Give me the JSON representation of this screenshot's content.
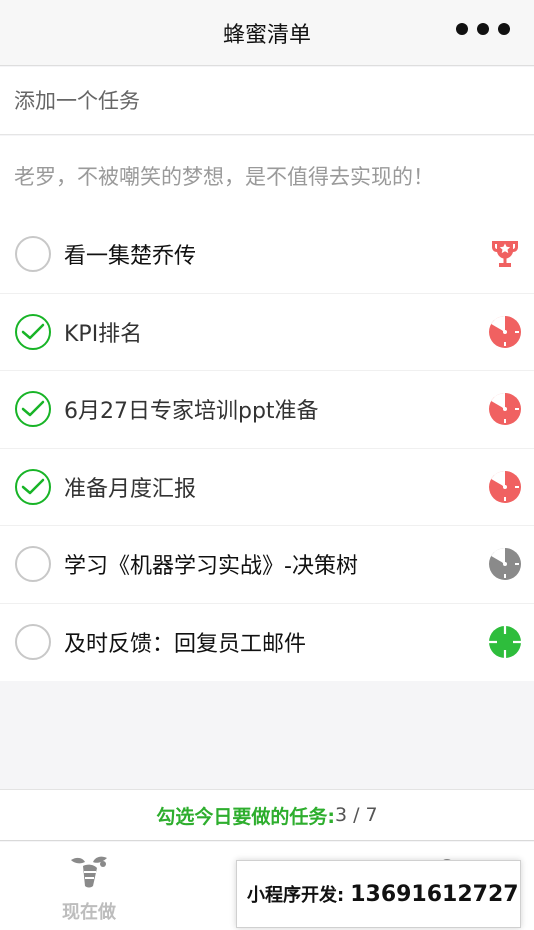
{
  "nav": {
    "title": "蜂蜜清单"
  },
  "add_task": {
    "placeholder": "添加一个任务"
  },
  "motto": "老罗，不被嘲笑的梦想，是不值得去实现的！",
  "tasks": [
    {
      "label": "看一集楚乔传",
      "done": false,
      "icon": "trophy-icon",
      "icon_color": "#f06161"
    },
    {
      "label": "KPI排名",
      "done": true,
      "icon": "clock-pie-icon",
      "icon_color": "#f06161"
    },
    {
      "label": "6月27日专家培训ppt准备",
      "done": true,
      "icon": "clock-pie-icon",
      "icon_color": "#f06161"
    },
    {
      "label": "准备月度汇报",
      "done": true,
      "icon": "clock-pie-icon",
      "icon_color": "#f06161"
    },
    {
      "label": "学习《机器学习实战》-决策树",
      "done": false,
      "icon": "clock-pie-icon",
      "icon_color": "#8a8a8a"
    },
    {
      "label": "及时反馈：回复员工邮件",
      "done": false,
      "icon": "target-icon",
      "icon_color": "#2ebd3c"
    }
  ],
  "footer": {
    "select_label": "勾选今日要做的任务:",
    "count": "3 / 7"
  },
  "tabs": [
    {
      "label": "现在做",
      "icon": "bee-icon"
    },
    {
      "label": "",
      "icon": "leaf-icon"
    },
    {
      "label": "",
      "icon": "user-icon"
    }
  ],
  "dev_popup": {
    "label": "小程序开发:",
    "phone": "13691612727"
  },
  "colors": {
    "accent_green": "#18b427",
    "alert_red": "#f06161",
    "muted_gray": "#8a8a8a"
  }
}
